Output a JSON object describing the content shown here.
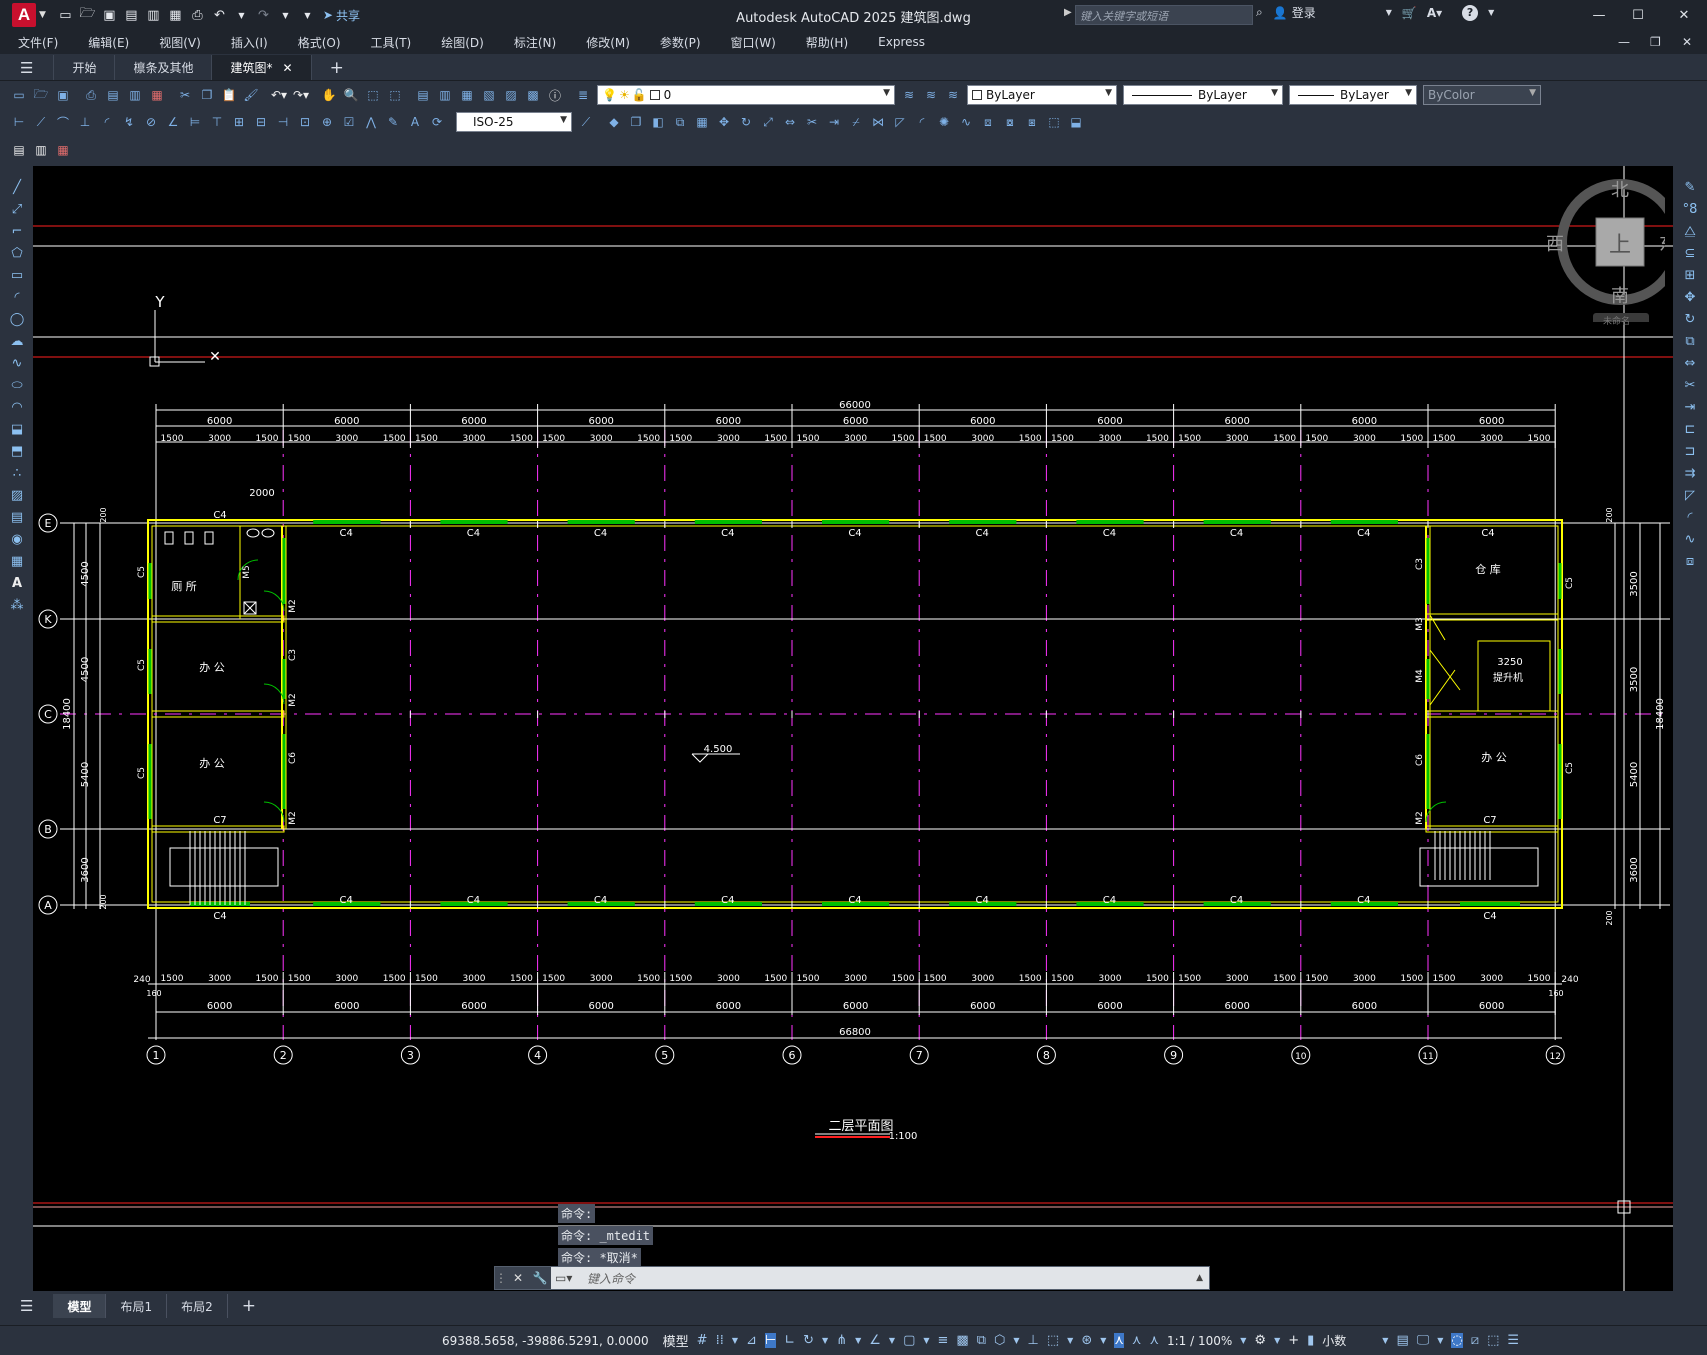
{
  "app": {
    "logo": "A",
    "title": "Autodesk AutoCAD 2025    建筑图.dwg",
    "share": "共享",
    "search_placeholder": "键入关键字或短语",
    "login": "登录"
  },
  "quick_access_icons": [
    "new-icon",
    "open-icon",
    "save-icon",
    "save-as-icon",
    "open-web-icon",
    "save-web-icon",
    "plot-icon",
    "undo-icon",
    "redo-icon",
    "dropdown-icon"
  ],
  "menus": [
    "文件(F)",
    "编辑(E)",
    "视图(V)",
    "插入(I)",
    "格式(O)",
    "工具(T)",
    "绘图(D)",
    "标注(N)",
    "修改(M)",
    "参数(P)",
    "窗口(W)",
    "帮助(H)",
    "Express"
  ],
  "tabs": [
    "开始",
    "檩条及其他",
    "建筑图*"
  ],
  "toolbar": {
    "layer": "0",
    "color": "ByLayer",
    "linetype": "ByLayer",
    "lineweight": "ByLayer",
    "plotstyle": "ByColor",
    "dimstyle": "ISO-25"
  },
  "viewcube": {
    "north": "北",
    "south": "南",
    "east": "东",
    "west": "西",
    "top": "上",
    "wcs": "未命名"
  },
  "drawing": {
    "total_top": "66000",
    "total_bottom": "66800",
    "bay": "6000",
    "sub_dims": [
      "1500",
      "3000",
      "1500"
    ],
    "grid_numbers": [
      "1",
      "2",
      "3",
      "4",
      "5",
      "6",
      "7",
      "8",
      "9",
      "10",
      "11",
      "12"
    ],
    "grid_letters": [
      "E",
      "K",
      "C",
      "B",
      "A"
    ],
    "rooms": [
      "厕 所",
      "办 公",
      "办 公",
      "仓 库",
      "提升机",
      "办 公"
    ],
    "window_tag": "C4",
    "level": "4.500",
    "plan_title": "二层平面图",
    "scale": "1:100",
    "side_total": "18400",
    "left_dims": [
      "4500",
      "4500",
      "5400",
      "3600"
    ],
    "right_dims": [
      "3500",
      "3500",
      "5400",
      "3600"
    ],
    "misc": [
      "2000",
      "3250",
      "240",
      "160",
      "200",
      "C5",
      "C6",
      "C7",
      "M2",
      "M3",
      "M4",
      "M5",
      "C3"
    ]
  },
  "command": {
    "history": [
      "命令:",
      "命令: _mtedit",
      "命令: *取消*"
    ],
    "placeholder": "键入命令"
  },
  "layouts": [
    "模型",
    "布局1",
    "布局2"
  ],
  "status": {
    "coords": "69388.5658, -39886.5291, 0.0000",
    "model": "模型",
    "scale": "1:1 / 100%",
    "units": "小数"
  }
}
